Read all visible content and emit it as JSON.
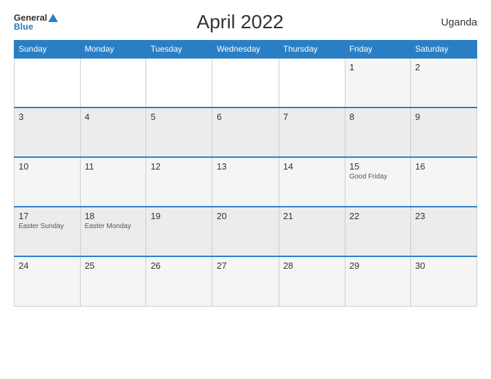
{
  "header": {
    "logo_general": "General",
    "logo_blue": "Blue",
    "title": "April 2022",
    "country": "Uganda"
  },
  "days_of_week": [
    "Sunday",
    "Monday",
    "Tuesday",
    "Wednesday",
    "Thursday",
    "Friday",
    "Saturday"
  ],
  "weeks": [
    [
      {
        "day": "",
        "event": "",
        "empty": true
      },
      {
        "day": "",
        "event": "",
        "empty": true
      },
      {
        "day": "",
        "event": "",
        "empty": true
      },
      {
        "day": "",
        "event": "",
        "empty": true
      },
      {
        "day": "",
        "event": "",
        "empty": true
      },
      {
        "day": "1",
        "event": ""
      },
      {
        "day": "2",
        "event": ""
      }
    ],
    [
      {
        "day": "3",
        "event": ""
      },
      {
        "day": "4",
        "event": ""
      },
      {
        "day": "5",
        "event": ""
      },
      {
        "day": "6",
        "event": ""
      },
      {
        "day": "7",
        "event": ""
      },
      {
        "day": "8",
        "event": ""
      },
      {
        "day": "9",
        "event": ""
      }
    ],
    [
      {
        "day": "10",
        "event": ""
      },
      {
        "day": "11",
        "event": ""
      },
      {
        "day": "12",
        "event": ""
      },
      {
        "day": "13",
        "event": ""
      },
      {
        "day": "14",
        "event": ""
      },
      {
        "day": "15",
        "event": "Good Friday"
      },
      {
        "day": "16",
        "event": ""
      }
    ],
    [
      {
        "day": "17",
        "event": "Easter Sunday"
      },
      {
        "day": "18",
        "event": "Easter Monday"
      },
      {
        "day": "19",
        "event": ""
      },
      {
        "day": "20",
        "event": ""
      },
      {
        "day": "21",
        "event": ""
      },
      {
        "day": "22",
        "event": ""
      },
      {
        "day": "23",
        "event": ""
      }
    ],
    [
      {
        "day": "24",
        "event": ""
      },
      {
        "day": "25",
        "event": ""
      },
      {
        "day": "26",
        "event": ""
      },
      {
        "day": "27",
        "event": ""
      },
      {
        "day": "28",
        "event": ""
      },
      {
        "day": "29",
        "event": ""
      },
      {
        "day": "30",
        "event": ""
      }
    ]
  ]
}
